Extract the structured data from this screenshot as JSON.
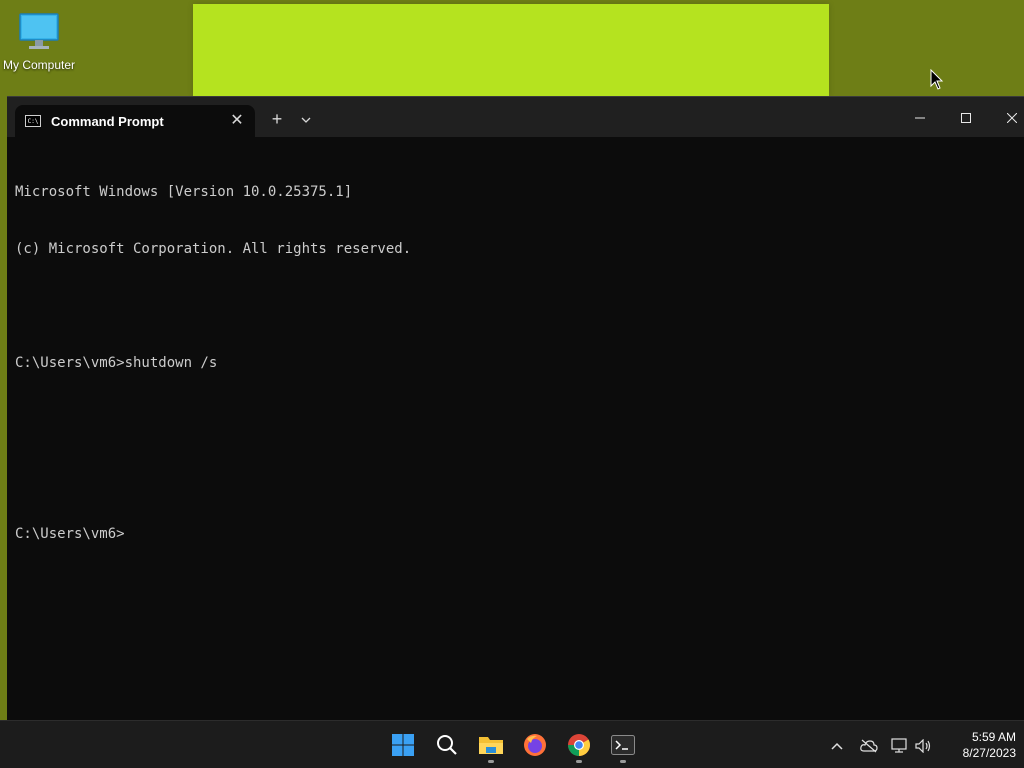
{
  "desktop": {
    "icons": [
      {
        "label": "My Computer",
        "icon": "monitor-icon"
      }
    ]
  },
  "terminal": {
    "tab": {
      "title": "Command Prompt",
      "icon": "cmd-icon"
    },
    "new_tab_label": "+",
    "close_tab_label": "✕",
    "dropdown_label": "⌄",
    "controls": {
      "minimize": "–",
      "maximize": "☐",
      "close": "✕"
    },
    "lines": [
      "Microsoft Windows [Version 10.0.25375.1]",
      "(c) Microsoft Corporation. All rights reserved.",
      "",
      "C:\\Users\\vm6>shutdown /s",
      "",
      "",
      "C:\\Users\\vm6>"
    ]
  },
  "taskbar": {
    "apps": [
      {
        "name": "start",
        "icon": "windows-logo-icon",
        "running": false
      },
      {
        "name": "search",
        "icon": "search-icon",
        "running": false
      },
      {
        "name": "file-explorer",
        "icon": "folder-icon",
        "running": true
      },
      {
        "name": "firefox",
        "icon": "firefox-icon",
        "running": false
      },
      {
        "name": "chrome",
        "icon": "chrome-icon",
        "running": true
      },
      {
        "name": "terminal",
        "icon": "terminal-icon",
        "running": true
      }
    ],
    "tray": {
      "chevron": "^",
      "icons": [
        "cloud-offline-icon",
        "network-icon",
        "volume-icon"
      ]
    },
    "clock": {
      "time": "5:59 AM",
      "date": "8/27/2023"
    }
  },
  "colors": {
    "desktop_bg": "#6e7e16",
    "bg_window": "#b5e31f",
    "terminal_bg": "#0c0c0c",
    "terminal_fg": "#cccccc",
    "taskbar_bg": "#1c1c1c"
  }
}
